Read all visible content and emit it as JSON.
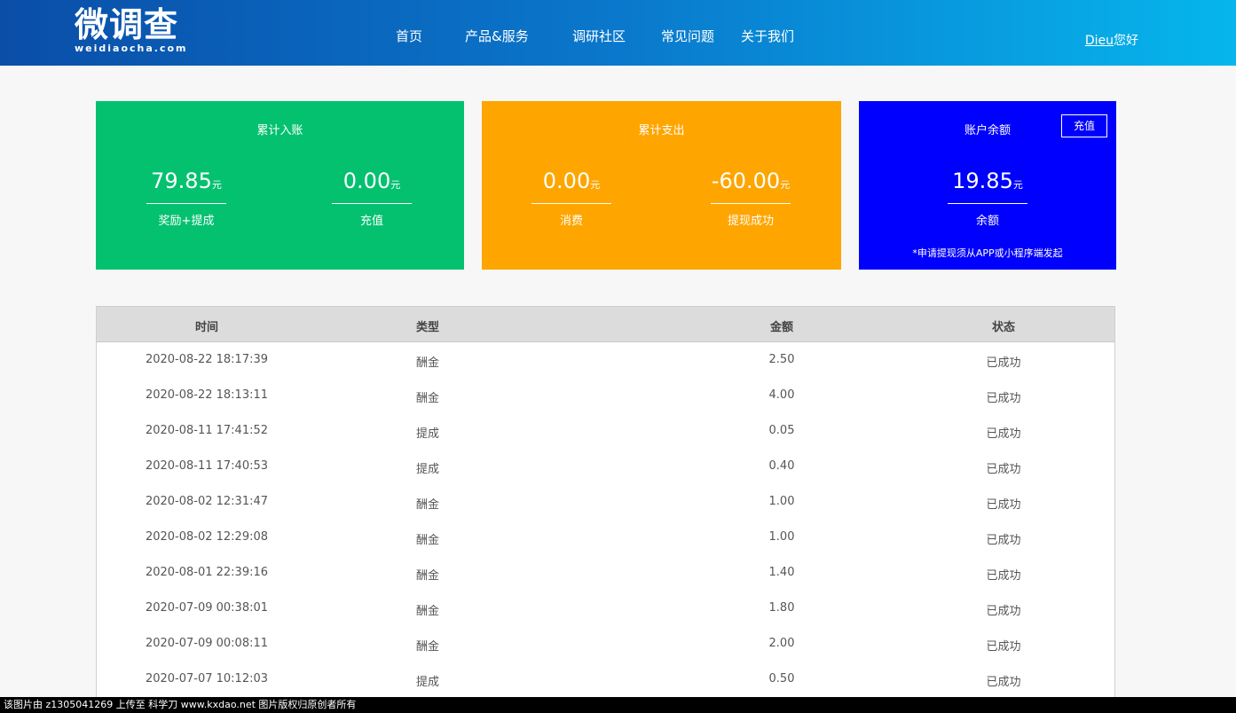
{
  "header": {
    "logo_main": "微调查",
    "logo_sub": "weidiaocha.com",
    "nav": [
      "首页",
      "产品&服务",
      "调研社区",
      "常见问题",
      "关于我们"
    ],
    "user_name": "Dieu",
    "greeting": "您好"
  },
  "income_card": {
    "title": "累计入账",
    "stats": [
      {
        "value": "79.85",
        "unit": "元",
        "label": "奖励+提成"
      },
      {
        "value": "0.00",
        "unit": "元",
        "label": "充值"
      }
    ]
  },
  "expense_card": {
    "title": "累计支出",
    "stats": [
      {
        "value": "0.00",
        "unit": "元",
        "label": "消费"
      },
      {
        "value": "-60.00",
        "unit": "元",
        "label": "提现成功"
      }
    ]
  },
  "balance_card": {
    "title": "账户余额",
    "recharge_label": "充值",
    "value": "19.85",
    "unit": "元",
    "label": "余额",
    "note": "*申请提现须从APP或小程序端发起"
  },
  "table": {
    "headers": [
      "时间",
      "类型",
      "金额",
      "状态"
    ],
    "rows": [
      [
        "2020-08-22 18:17:39",
        "酬金",
        "2.50",
        "已成功"
      ],
      [
        "2020-08-22 18:13:11",
        "酬金",
        "4.00",
        "已成功"
      ],
      [
        "2020-08-11 17:41:52",
        "提成",
        "0.05",
        "已成功"
      ],
      [
        "2020-08-11 17:40:53",
        "提成",
        "0.40",
        "已成功"
      ],
      [
        "2020-08-02 12:31:47",
        "酬金",
        "1.00",
        "已成功"
      ],
      [
        "2020-08-02 12:29:08",
        "酬金",
        "1.00",
        "已成功"
      ],
      [
        "2020-08-01 22:39:16",
        "酬金",
        "1.40",
        "已成功"
      ],
      [
        "2020-07-09 00:38:01",
        "酬金",
        "1.80",
        "已成功"
      ],
      [
        "2020-07-09 00:08:11",
        "酬金",
        "2.00",
        "已成功"
      ],
      [
        "2020-07-07 10:12:03",
        "提成",
        "0.50",
        "已成功"
      ]
    ]
  },
  "watermark": "该图片由 z1305041269 上传至 科学刀 www.kxdao.net 图片版权归原创者所有",
  "colors": {
    "income": "#04c170",
    "expense": "#fea500",
    "balance": "#0000fe",
    "header_start": "#0a4ea8",
    "header_end": "#06b6ec"
  }
}
